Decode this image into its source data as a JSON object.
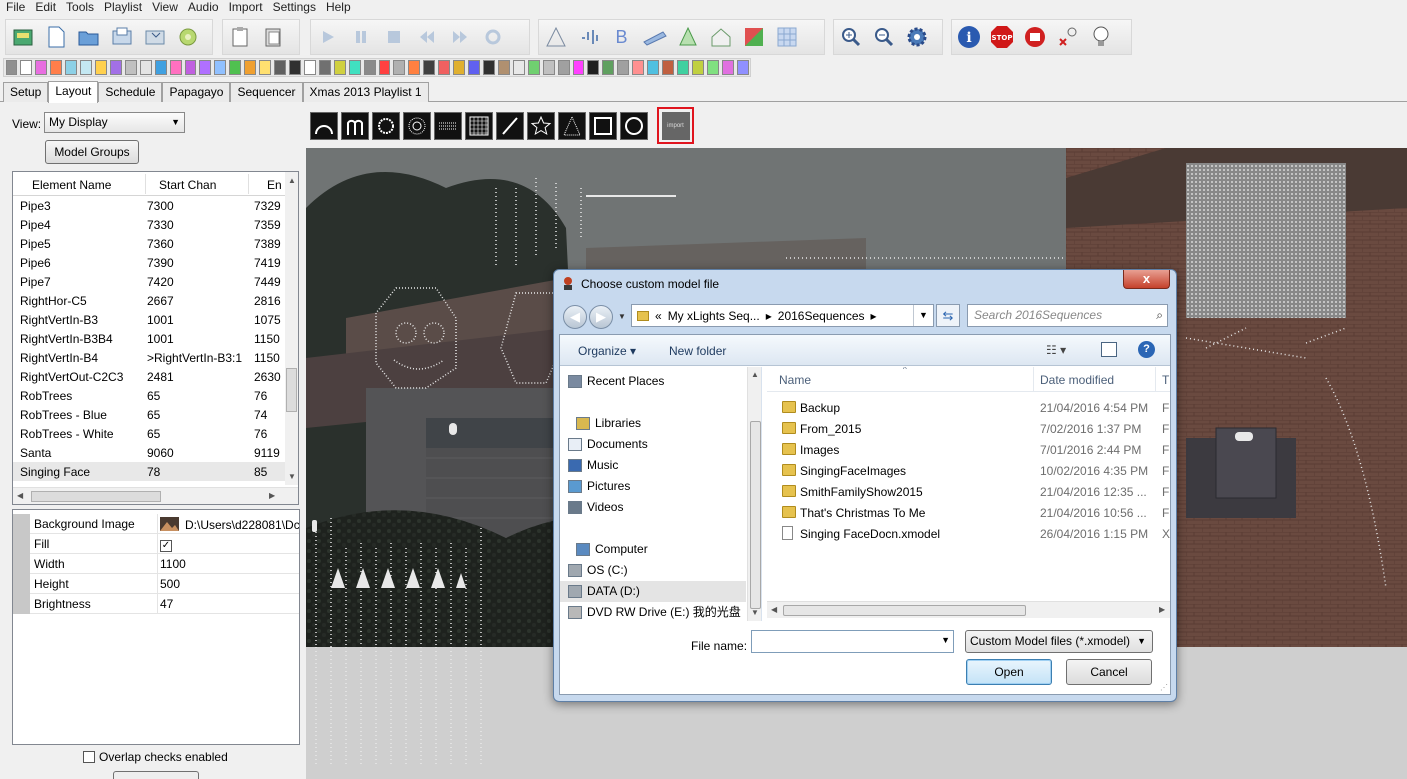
{
  "menu": [
    "File",
    "Edit",
    "Tools",
    "Playlist",
    "View",
    "Audio",
    "Import",
    "Settings",
    "Help"
  ],
  "toolbar_icons": {
    "file": [
      "open-folder-icon",
      "new-file-icon",
      "open-file-icon",
      "save-icon",
      "save-as-icon",
      "render-icon"
    ],
    "clipboard": [
      "paste-icon",
      "copy-icon"
    ],
    "playback": [
      "play-icon",
      "pause-icon",
      "stop-icon",
      "first-frame-icon",
      "last-frame-icon",
      "replay-icon"
    ],
    "tools": [
      "triangle-icon",
      "sparkle-icon",
      "bold-icon",
      "model-icon",
      "tree-icon",
      "house-icon",
      "color-icon",
      "grid-icon"
    ],
    "view": [
      "zoom-in-icon",
      "zoom-out-icon",
      "settings-icon"
    ],
    "status": [
      "info-icon",
      "stop-sign-icon",
      "record-icon",
      "output-toggle-icon",
      "bulb-icon"
    ]
  },
  "effect_colors": [
    "#909090",
    "#ffffff",
    "#e86ee0",
    "#ff7e4a",
    "#8dd0e6",
    "#c4e8f2",
    "#ffd04e",
    "#a270e6",
    "#c0c0c0",
    "#e4e4e4",
    "#40a0e0",
    "#ff70c0",
    "#c060e0",
    "#b070ff",
    "#90c0ff",
    "#50c050",
    "#f0a030",
    "#ffe070",
    "#606060",
    "#303030",
    "#ffffff",
    "#707070",
    "#d0d040",
    "#40e0c0",
    "#8a8a8a",
    "#ff4040",
    "#b0b0b0",
    "#ff8040",
    "#404040",
    "#f06060",
    "#e0b030",
    "#6060f0",
    "#303030",
    "#b09070",
    "#e8e8e8",
    "#70d070",
    "#c0c0c0",
    "#a0a0a0",
    "#ff40ff",
    "#202020",
    "#60a060",
    "#a0a0a0",
    "#ff9090",
    "#50c0e0",
    "#c06040",
    "#40d0a0",
    "#c0d040",
    "#80e080",
    "#e070e0",
    "#9090ff"
  ],
  "tabs": [
    "Setup",
    "Layout",
    "Schedule",
    "Papagayo",
    "Sequencer",
    "Xmas 2013 Playlist 1"
  ],
  "active_tab": "Layout",
  "layout": {
    "view_label": "View:",
    "view_value": "My Display",
    "model_groups_btn": "Model Groups",
    "columns": [
      "Element Name",
      "Start Chan",
      "En"
    ],
    "rows": [
      [
        "Pipe3",
        "7300",
        "7329"
      ],
      [
        "Pipe4",
        "7330",
        "7359"
      ],
      [
        "Pipe5",
        "7360",
        "7389"
      ],
      [
        "Pipe6",
        "7390",
        "7419"
      ],
      [
        "Pipe7",
        "7420",
        "7449"
      ],
      [
        "RightHor-C5",
        "2667",
        "2816"
      ],
      [
        "RightVertIn-B3",
        "1001",
        "1075"
      ],
      [
        "RightVertIn-B3B4",
        "1001",
        "1150"
      ],
      [
        "RightVertIn-B4",
        ">RightVertIn-B3:1",
        "1150"
      ],
      [
        "RightVertOut-C2C3",
        "2481",
        "2630"
      ],
      [
        "RobTrees",
        "65",
        "76"
      ],
      [
        "RobTrees - Blue",
        "65",
        "74"
      ],
      [
        "RobTrees - White",
        "65",
        "76"
      ],
      [
        "Santa",
        "9060",
        "9119"
      ],
      [
        "Singing Face",
        "78",
        "85"
      ]
    ],
    "selected_row": "Singing Face",
    "properties": [
      {
        "key": "Background Image",
        "value": "D:\\Users\\d228081\\Dc"
      },
      {
        "key": "Fill",
        "value": "✓"
      },
      {
        "key": "Width",
        "value": "1100"
      },
      {
        "key": "Height",
        "value": "500"
      },
      {
        "key": "Brightness",
        "value": "47"
      }
    ],
    "overlap_label": "Overlap checks enabled"
  },
  "shape_tools": [
    "arch-icon",
    "candy-cane-icon",
    "circle-icon",
    "star-wreath-icon",
    "matrix-icon",
    "grid-icon",
    "line-icon",
    "star-icon",
    "tree-icon",
    "square-icon",
    "circle-outline-icon"
  ],
  "import_label": "import",
  "dialog": {
    "title": "Choose custom model file",
    "breadcrumb": [
      "«",
      "My xLights Seq...",
      "▸",
      "2016Sequences",
      "▸"
    ],
    "search_placeholder": "Search 2016Sequences",
    "organize": "Organize ▾",
    "new_folder": "New folder",
    "nav": [
      {
        "label": "Recent Places",
        "icon": "recent-places-icon"
      },
      {
        "label": "Libraries",
        "icon": "libraries-icon"
      },
      {
        "label": "Documents",
        "icon": "documents-icon"
      },
      {
        "label": "Music",
        "icon": "music-icon"
      },
      {
        "label": "Pictures",
        "icon": "pictures-icon"
      },
      {
        "label": "Videos",
        "icon": "videos-icon"
      },
      {
        "label": "Computer",
        "icon": "computer-icon"
      },
      {
        "label": "OS (C:)",
        "icon": "drive-icon"
      },
      {
        "label": "DATA (D:)",
        "icon": "drive-icon"
      },
      {
        "label": "DVD RW Drive (E:) 我的光盘",
        "icon": "dvd-drive-icon"
      }
    ],
    "nav_selected": "DATA (D:)",
    "columns": [
      "Name",
      "Date modified",
      "T"
    ],
    "files": [
      {
        "name": "Backup",
        "date": "21/04/2016 4:54 PM",
        "type": "F",
        "kind": "folder"
      },
      {
        "name": "From_2015",
        "date": "7/02/2016 1:37 PM",
        "type": "F",
        "kind": "folder"
      },
      {
        "name": "Images",
        "date": "7/01/2016 2:44 PM",
        "type": "F",
        "kind": "folder"
      },
      {
        "name": "SingingFaceImages",
        "date": "10/02/2016 4:35 PM",
        "type": "F",
        "kind": "folder"
      },
      {
        "name": "SmithFamilyShow2015",
        "date": "21/04/2016 12:35 ...",
        "type": "F",
        "kind": "folder"
      },
      {
        "name": "That's Christmas To Me",
        "date": "21/04/2016 10:56 ...",
        "type": "F",
        "kind": "folder"
      },
      {
        "name": "Singing FaceDocn.xmodel",
        "date": "26/04/2016 1:15 PM",
        "type": "X",
        "kind": "file"
      }
    ],
    "file_name_label": "File name:",
    "file_name_value": "",
    "file_type": "Custom Model files (*.xmodel)",
    "open_btn": "Open",
    "cancel_btn": "Cancel",
    "close_btn": "x"
  }
}
